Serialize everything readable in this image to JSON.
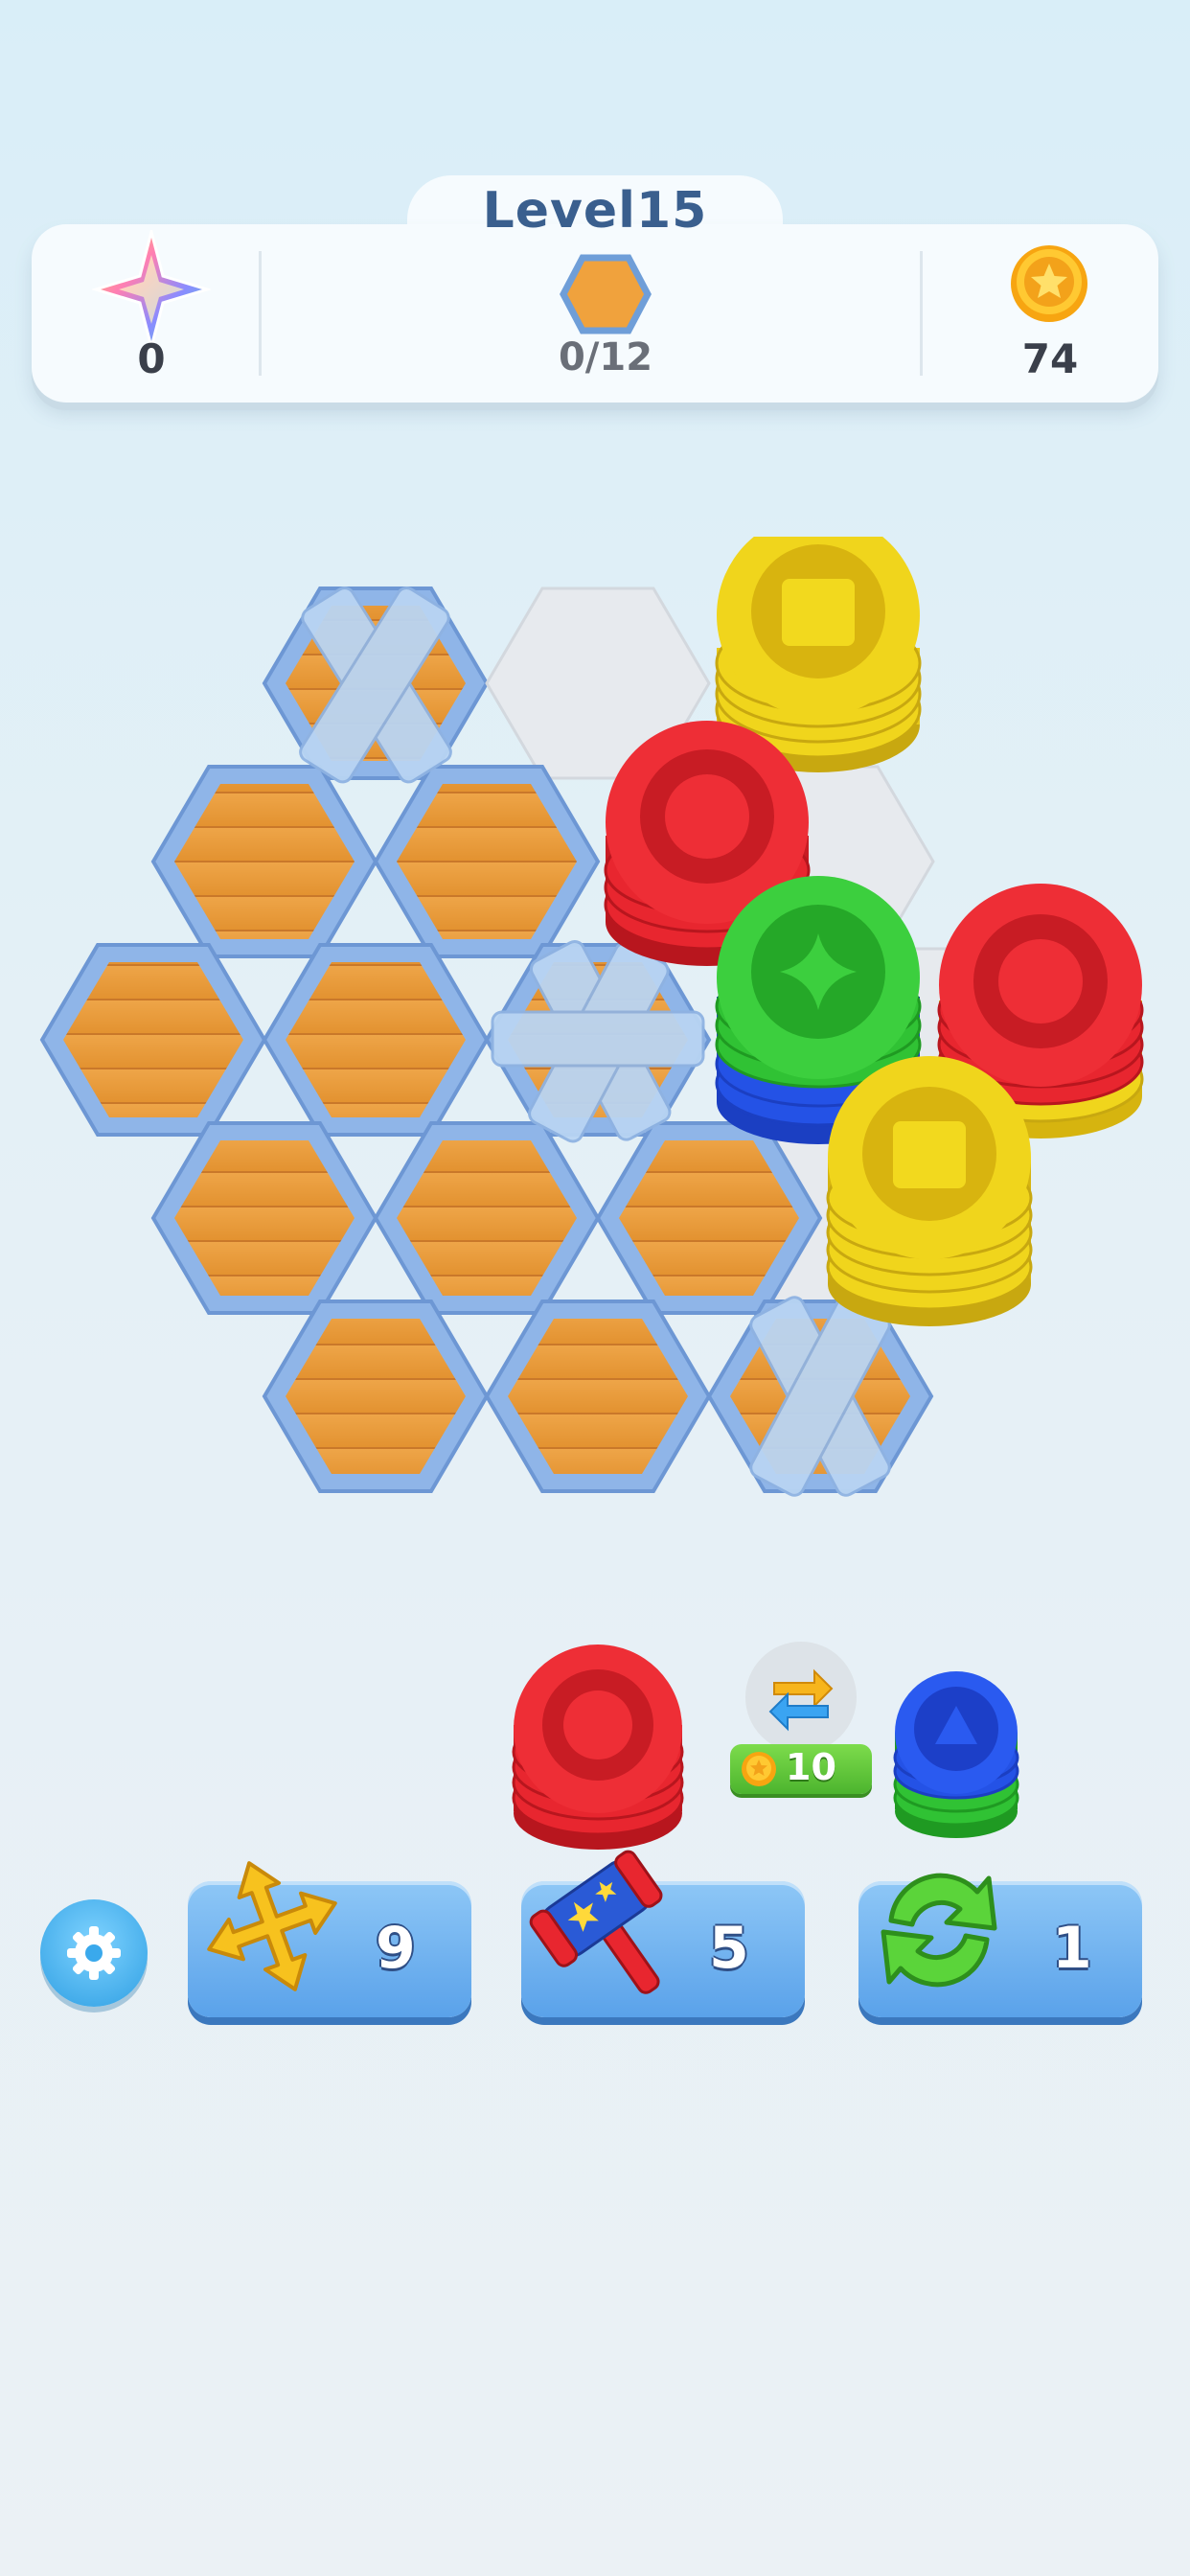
{
  "header": {
    "level_label": "Level15",
    "stars": "0",
    "tiles_progress": "0/12",
    "coins": "74"
  },
  "icons": {
    "stars": "rainbow-star-icon",
    "tiles": "orange-hex-icon",
    "coins": "gold-coin-icon",
    "settings": "gear-icon",
    "swap": "swap-arrows-icon",
    "booster1": "move-arrows-icon",
    "booster2": "hammer-icon",
    "booster3": "refresh-icon"
  },
  "tray": {
    "swap_price": "10",
    "stacks": [
      "red",
      "blue-green"
    ]
  },
  "boosters": [
    {
      "name": "move",
      "count": "9"
    },
    {
      "name": "hammer",
      "count": "5"
    },
    {
      "name": "shuffle",
      "count": "1"
    }
  ],
  "colors": {
    "red": "#e8262f",
    "yellow": "#f2d51c",
    "green": "#32c436",
    "blue": "#1f4fe0",
    "wood": "#e79a3c",
    "hex_frame": "#8fb5e8"
  }
}
